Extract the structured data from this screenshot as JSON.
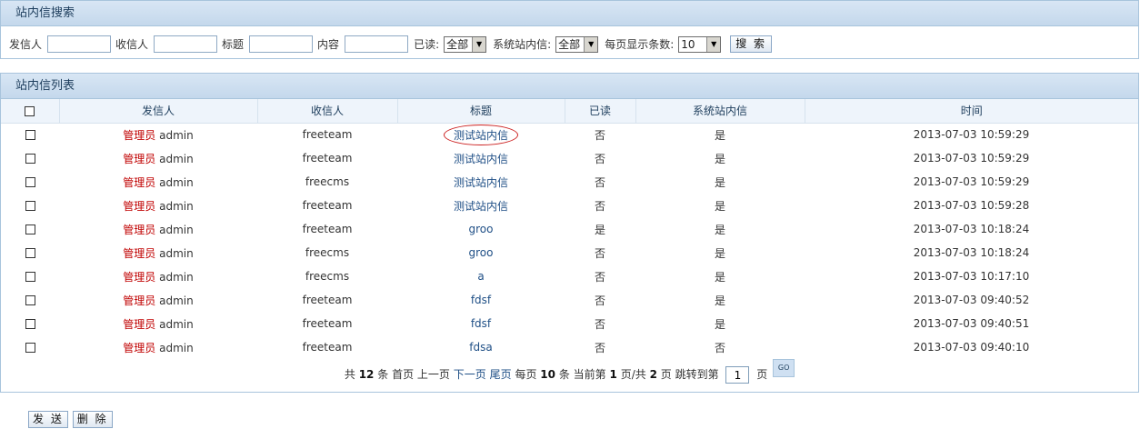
{
  "search": {
    "title": "站内信搜索",
    "sender_label": "发信人",
    "receiver_label": "收信人",
    "title_label": "标题",
    "content_label": "内容",
    "read_label": "已读:",
    "read_value": "全部",
    "system_label": "系统站内信:",
    "system_value": "全部",
    "pagesize_label": "每页显示条数:",
    "pagesize_value": "10",
    "search_button": "搜 索"
  },
  "list": {
    "title": "站内信列表",
    "columns": [
      "发信人",
      "收信人",
      "标题",
      "已读",
      "系统站内信",
      "时间"
    ],
    "rows": [
      {
        "role": "管理员",
        "sender": "admin",
        "receiver": "freeteam",
        "title": "测试站内信",
        "read": "否",
        "system": "是",
        "time": "2013-07-03 10:59:29"
      },
      {
        "role": "管理员",
        "sender": "admin",
        "receiver": "freeteam",
        "title": "测试站内信",
        "read": "否",
        "system": "是",
        "time": "2013-07-03 10:59:29"
      },
      {
        "role": "管理员",
        "sender": "admin",
        "receiver": "freecms",
        "title": "测试站内信",
        "read": "否",
        "system": "是",
        "time": "2013-07-03 10:59:29"
      },
      {
        "role": "管理员",
        "sender": "admin",
        "receiver": "freeteam",
        "title": "测试站内信",
        "read": "否",
        "system": "是",
        "time": "2013-07-03 10:59:28"
      },
      {
        "role": "管理员",
        "sender": "admin",
        "receiver": "freeteam",
        "title": "groo",
        "read": "是",
        "system": "是",
        "time": "2013-07-03 10:18:24"
      },
      {
        "role": "管理员",
        "sender": "admin",
        "receiver": "freecms",
        "title": "groo",
        "read": "否",
        "system": "是",
        "time": "2013-07-03 10:18:24"
      },
      {
        "role": "管理员",
        "sender": "admin",
        "receiver": "freecms",
        "title": "a",
        "read": "否",
        "system": "是",
        "time": "2013-07-03 10:17:10"
      },
      {
        "role": "管理员",
        "sender": "admin",
        "receiver": "freeteam",
        "title": "fdsf",
        "read": "否",
        "system": "是",
        "time": "2013-07-03 09:40:52"
      },
      {
        "role": "管理员",
        "sender": "admin",
        "receiver": "freeteam",
        "title": "fdsf",
        "read": "否",
        "system": "是",
        "time": "2013-07-03 09:40:51"
      },
      {
        "role": "管理员",
        "sender": "admin",
        "receiver": "freeteam",
        "title": "fdsa",
        "read": "否",
        "system": "否",
        "time": "2013-07-03 09:40:10"
      }
    ]
  },
  "pager": {
    "total_prefix": "共",
    "total": "12",
    "total_suffix": "条",
    "first": "首页",
    "prev": "上一页",
    "next": "下一页",
    "last": "尾页",
    "per_prefix": "每页",
    "per": "10",
    "per_suffix": "条",
    "current_prefix": "当前第",
    "current": "1",
    "pages_mid": "页/共",
    "pages": "2",
    "pages_suffix": "页",
    "jump_label": "跳转到第",
    "jump_value": "1",
    "jump_suffix": "页",
    "go": "GO"
  },
  "actions": {
    "send": "发 送",
    "delete": "删 除"
  }
}
